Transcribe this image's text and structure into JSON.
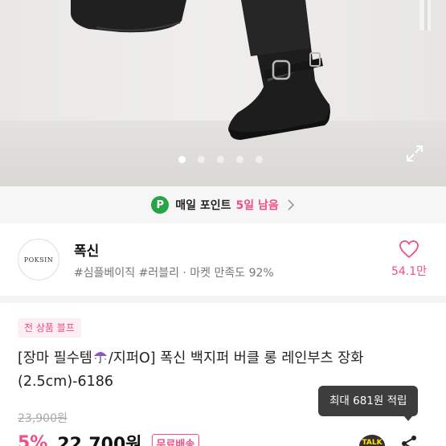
{
  "hero": {
    "image_count": 5,
    "active_index": 0,
    "icon": "expand-icon"
  },
  "point_bar": {
    "badge": "P",
    "label": "매일 포인트",
    "remaining": "5일 남음",
    "icon": "chevron-right-icon"
  },
  "shop": {
    "logo_text": "POKSIN",
    "name": "폭신",
    "tags": "#심플베이직 #러블리 · 마켓 만족도 92%",
    "likes": "54.1만",
    "like_icon": "heart-icon"
  },
  "product": {
    "badge": "전 상품 블프",
    "title_part1": "[장마 필수템",
    "title_part2": "/지퍼O] 폭신 백지퍼 버클 롱 레인부츠 장화 (2.5cm)-6186",
    "original_price": "23,900원",
    "discount": "5%",
    "price": "22,700원",
    "shipping": "무료배송",
    "reward_tooltip": "최대 681원 적립",
    "talk_label": "TALK",
    "share_icon": "share-icon"
  },
  "colors": {
    "accent": "#f04e85",
    "point_green": "#26a546",
    "tooltip_bg": "#3d3d3d"
  }
}
